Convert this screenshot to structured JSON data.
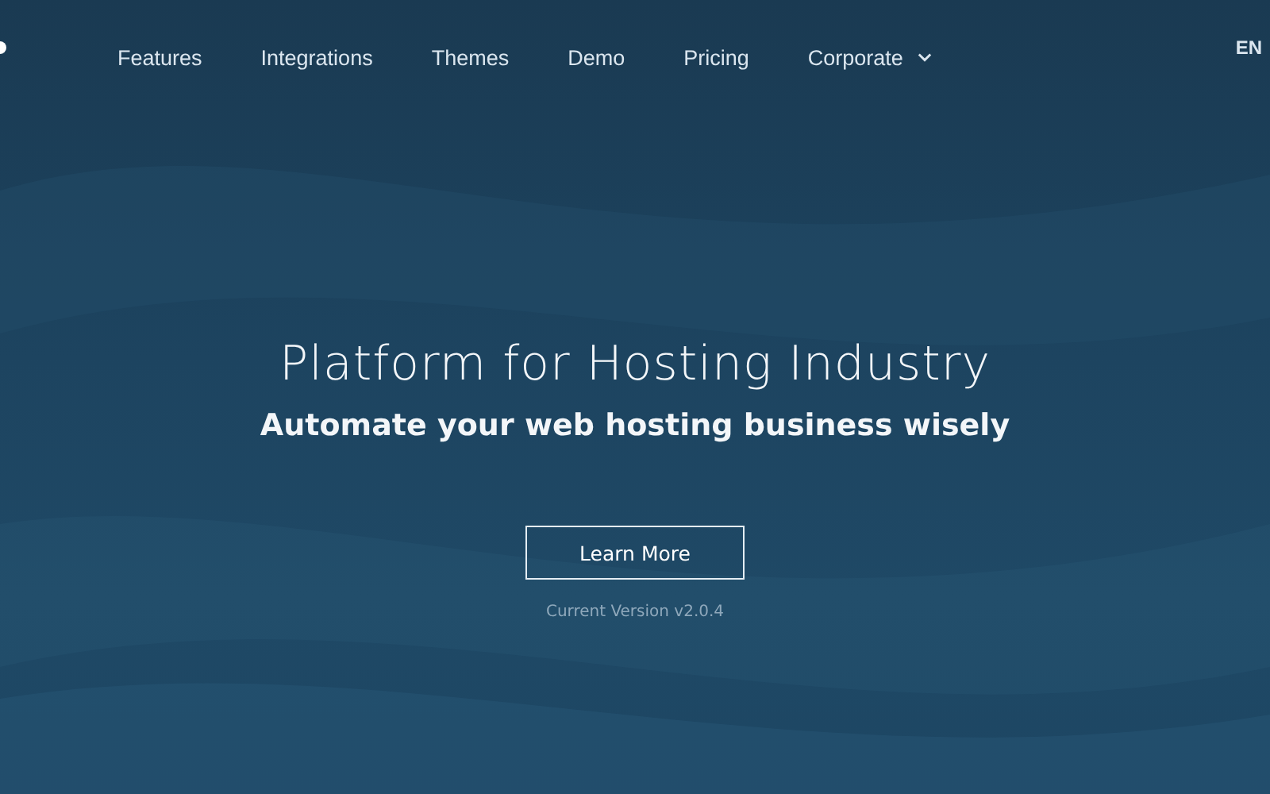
{
  "nav": {
    "items": [
      {
        "label": "Features",
        "dropdown": false
      },
      {
        "label": "Integrations",
        "dropdown": false
      },
      {
        "label": "Themes",
        "dropdown": false
      },
      {
        "label": "Demo",
        "dropdown": false
      },
      {
        "label": "Pricing",
        "dropdown": false
      },
      {
        "label": "Corporate",
        "dropdown": true
      }
    ],
    "language": "EN"
  },
  "hero": {
    "title": "Platform for Hosting Industry",
    "subtitle": "Automate your web hosting business wisely",
    "button": "Learn More",
    "version": "Current Version v2.0.4"
  }
}
